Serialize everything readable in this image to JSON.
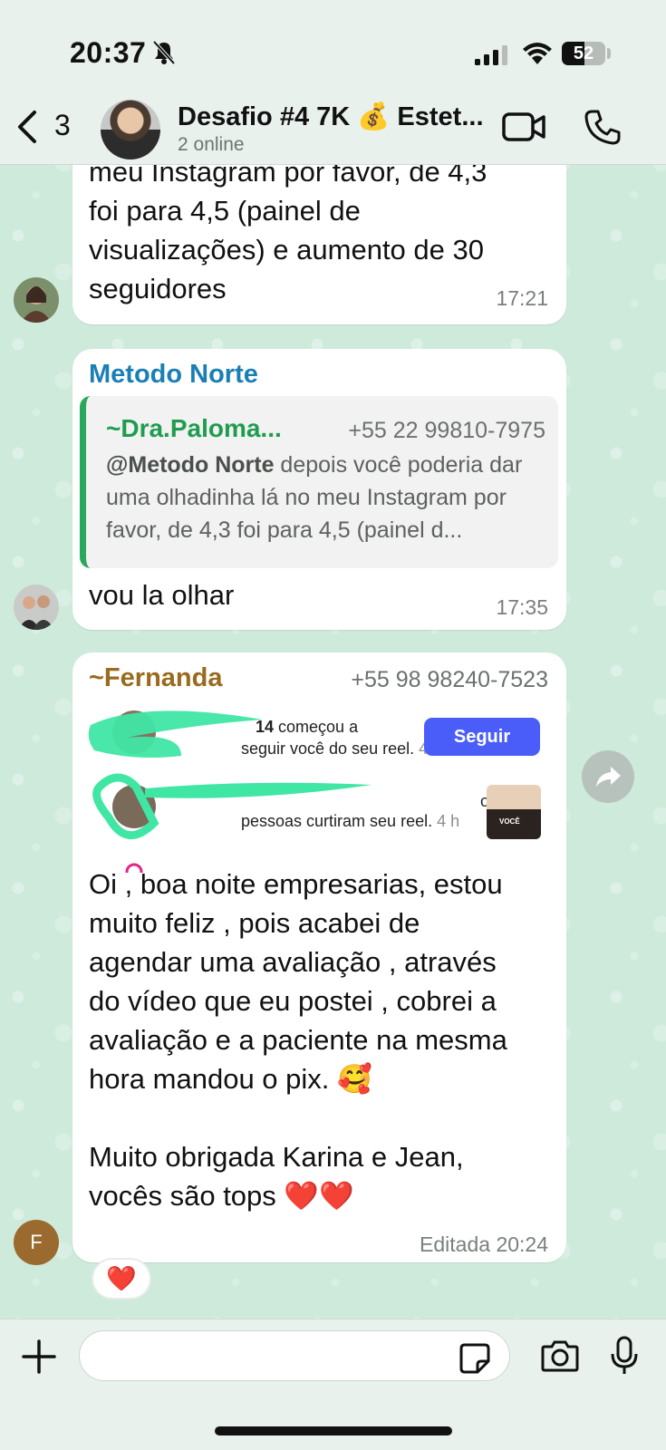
{
  "status": {
    "time": "20:37",
    "battery": "52",
    "battery_level": 0.52
  },
  "header": {
    "back_count": "3",
    "title": "Desafio #4 7K 💰 Estet...",
    "subtitle": "2 online"
  },
  "messages": [
    {
      "text_lines": [
        "meu Instagram por favor, de 4,3",
        "foi para 4,5 (painel de",
        "visualizações) e aumento de 30",
        "seguidores"
      ],
      "time": "17:21"
    },
    {
      "sender": "Metodo Norte",
      "quote": {
        "name": "~Dra.Paloma...",
        "phone": "+55 22 99810-7975",
        "mention": "@Metodo Norte",
        "text": " depois você poderia dar uma olhadinha lá no meu Instagram por favor, de 4,3 foi para 4,5 (painel d..."
      },
      "text": "vou la olhar",
      "time": "17:35"
    },
    {
      "sender": "~Fernanda",
      "phone": "+55 98 98240-7523",
      "screenshot": {
        "notif1_text_bold": "14",
        "notif1_text": " começou a",
        "notif1_line2": "seguir você do seu reel.",
        "notif1_age": "4 h",
        "follow_label": "Seguir",
        "notif2_text": "outras",
        "notif2_line2": "pessoas curtiram seu reel.",
        "notif2_age": "4 h",
        "thumb_label": "VOCÊ"
      },
      "text_lines": [
        "Oi , boa noite empresarias, estou",
        "muito feliz , pois acabei de",
        "agendar uma avaliação , através",
        "do vídeo que eu postei , cobrei a",
        "avaliação e a paciente na mesma",
        "hora mandou o pix. 🥰",
        "",
        "Muito obrigada Karina e Jean,",
        "vocês são tops ❤️❤️"
      ],
      "time": "Editada 20:24",
      "avatar_letter": "F",
      "reaction": "❤️"
    }
  ],
  "input": {
    "placeholder": ""
  },
  "colors": {
    "quote_accent": "#2aa85b",
    "sender_metodo": "#1a7fb5",
    "sender_fernanda": "#9a6a1f",
    "follow_button": "#4a5df9",
    "highlight_scribble": "#3fe6a4"
  }
}
